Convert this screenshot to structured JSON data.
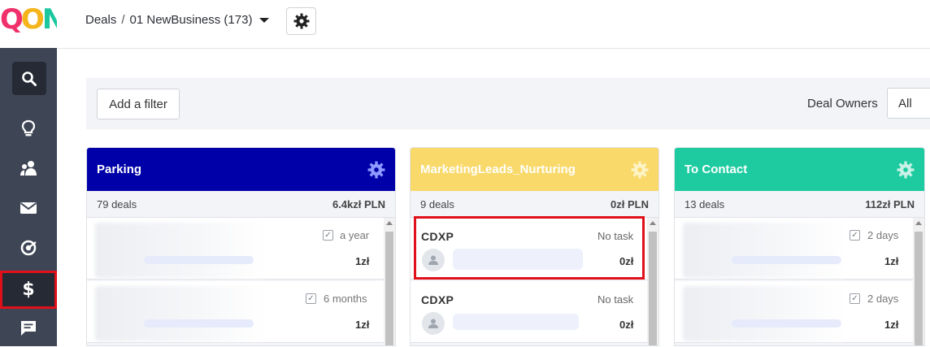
{
  "logo": {
    "text_left": "Q",
    "text_mid": "O",
    "text_right": "N",
    "colors": [
      "#f0306a",
      "#f4b41a",
      "#1cc7a0"
    ]
  },
  "sidebar": {
    "items": [
      {
        "icon": "search-icon",
        "active": false
      },
      {
        "icon": "lightbulb-icon",
        "active": false
      },
      {
        "icon": "contacts-icon",
        "active": false
      },
      {
        "icon": "mail-icon",
        "active": false
      },
      {
        "icon": "target-icon",
        "active": false
      },
      {
        "icon": "dollar-icon",
        "label": "$",
        "active": true
      },
      {
        "icon": "chat-icon",
        "active": false
      }
    ]
  },
  "header": {
    "breadcrumb_root": "Deals",
    "breadcrumb_sep": "/",
    "breadcrumb_current": "01 NewBusiness (173)"
  },
  "filters": {
    "add_filter_label": "Add a filter",
    "deal_owners_label": "Deal Owners",
    "deal_owners_value": "All"
  },
  "columns": [
    {
      "name": "Parking",
      "color": "#0000a8",
      "deals_count": "79 deals",
      "amount": "6.4kzł PLN",
      "cards": [
        {
          "due": "a year",
          "value": "1zł"
        },
        {
          "due": "6 months",
          "value": "1zł"
        }
      ]
    },
    {
      "name": "MarketingLeads_Nurturing",
      "color": "#f8d96a",
      "deals_count": "9 deals",
      "amount": "0zł PLN",
      "cards": [
        {
          "name": "CDXP",
          "task": "No task",
          "value": "0zł"
        },
        {
          "name": "CDXP",
          "task": "No task",
          "value": "0zł"
        }
      ]
    },
    {
      "name": "To Contact",
      "color": "#1ecba1",
      "deals_count": "13 deals",
      "amount": "112zł PLN",
      "cards": [
        {
          "due": "2 days",
          "value": "1zł"
        },
        {
          "due": "2 days",
          "value": "1zł"
        }
      ]
    }
  ]
}
